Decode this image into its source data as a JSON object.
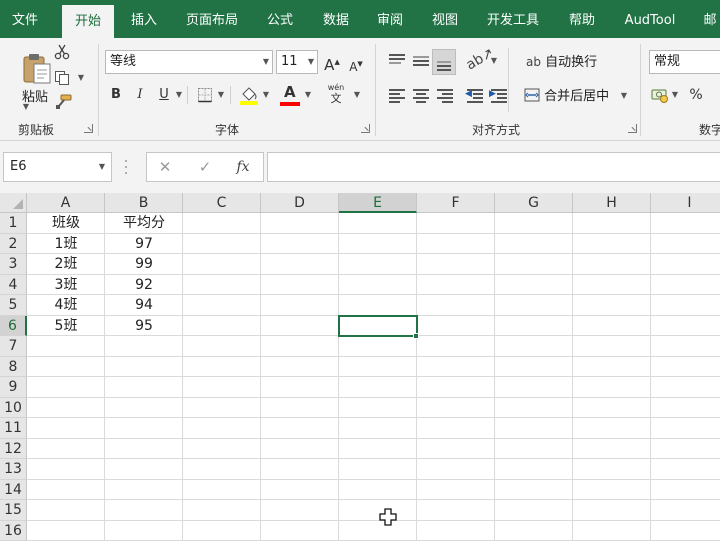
{
  "tabs": [
    {
      "label": "文件",
      "active": false
    },
    {
      "label": "开始",
      "active": true
    },
    {
      "label": "插入",
      "active": false
    },
    {
      "label": "页面布局",
      "active": false
    },
    {
      "label": "公式",
      "active": false
    },
    {
      "label": "数据",
      "active": false
    },
    {
      "label": "审阅",
      "active": false
    },
    {
      "label": "视图",
      "active": false
    },
    {
      "label": "开发工具",
      "active": false
    },
    {
      "label": "帮助",
      "active": false
    },
    {
      "label": "AudTool",
      "active": false
    },
    {
      "label": "邮",
      "active": false
    }
  ],
  "clipboard": {
    "paste_label": "粘贴",
    "group_label": "剪贴板"
  },
  "font": {
    "font_name": "等线",
    "font_size": "11",
    "grow_label": "A",
    "shrink_label": "A",
    "bold_label": "B",
    "italic_label": "I",
    "underline_label": "U",
    "fill_color": "#ffff00",
    "font_color": "#ff0000",
    "font_color_label": "A",
    "phonetic_top": "wén",
    "phonetic_bottom": "文",
    "group_label": "字体"
  },
  "alignment": {
    "wrap_label": "自动换行",
    "merge_label": "合并后居中",
    "group_label": "对齐方式"
  },
  "number": {
    "format": "常规",
    "percent_label": "%",
    "group_label": "数字"
  },
  "formula_bar": {
    "name_box": "E6",
    "cancel_symbol": "✕",
    "enter_symbol": "✓",
    "fx_label": "fx",
    "content": ""
  },
  "sheet": {
    "columns": [
      "A",
      "B",
      "C",
      "D",
      "E",
      "F",
      "G",
      "H",
      "I"
    ],
    "rows": [
      "1",
      "2",
      "3",
      "4",
      "5",
      "6",
      "7",
      "8",
      "9",
      "10",
      "11",
      "12",
      "13",
      "14",
      "15",
      "16"
    ],
    "selected_column": "E",
    "selected_row": "6",
    "cells": [
      [
        "班级",
        "平均分"
      ],
      [
        "1班",
        "97"
      ],
      [
        "2班",
        "99"
      ],
      [
        "3班",
        "92"
      ],
      [
        "4班",
        "94"
      ],
      [
        "5班",
        "95"
      ]
    ]
  },
  "colors": {
    "accent": "#217346",
    "ribbon_bg": "#f3f3f3"
  }
}
